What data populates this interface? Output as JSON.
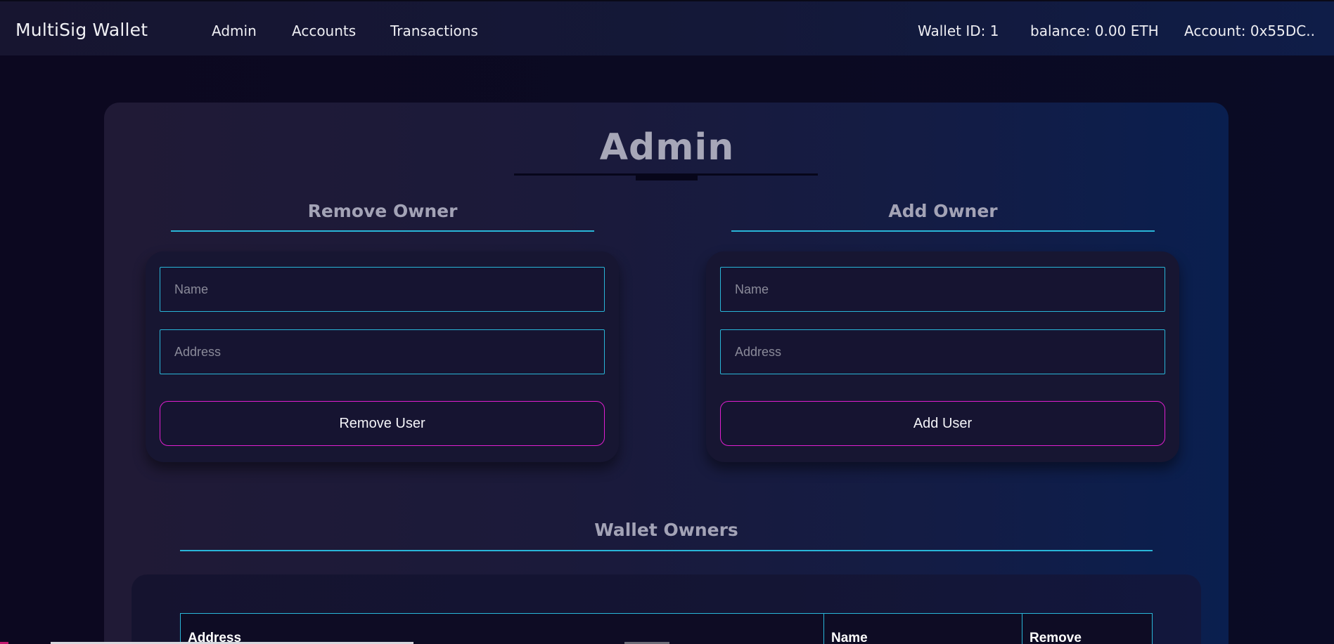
{
  "navbar": {
    "brand": "MultiSig Wallet",
    "links": [
      "Admin",
      "Accounts",
      "Transactions"
    ],
    "wallet_id": "Wallet ID: 1",
    "balance": "balance: 0.00 ETH",
    "account": "Account: 0x55DC.."
  },
  "admin": {
    "title": "Admin",
    "remove_owner": {
      "heading": "Remove Owner",
      "name_placeholder": "Name",
      "address_placeholder": "Address",
      "button_label": "Remove User"
    },
    "add_owner": {
      "heading": "Add Owner",
      "name_placeholder": "Name",
      "address_placeholder": "Address",
      "button_label": "Add User"
    },
    "wallet_owners": {
      "heading": "Wallet Owners",
      "columns": [
        "Address",
        "Name",
        "Remove"
      ]
    }
  },
  "colors": {
    "accent_cyan": "#29b6d8",
    "accent_magenta": "#e01fd0"
  }
}
